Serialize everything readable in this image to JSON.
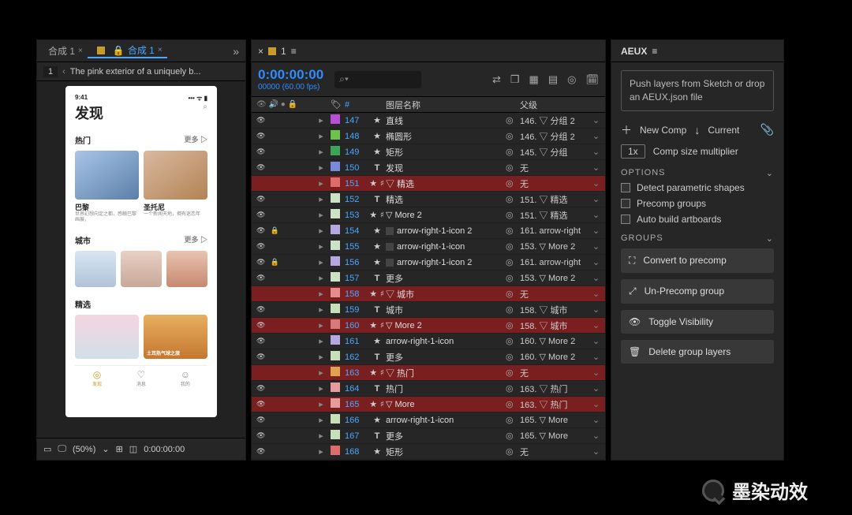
{
  "left": {
    "tab1": "合成 1",
    "tab2": "合成 1",
    "crumb_num": "1",
    "crumb_text": "The pink exterior of a uniquely b...",
    "zoom": "(50%)",
    "foot_time": "0:00:00:00",
    "phone": {
      "time": "9:41",
      "title": "发现",
      "sec_hot": "热门",
      "more": "更多 ▷",
      "card1": "巴黎",
      "card1_sub": "世界幻想向定之都，感触巴黎画展，",
      "card2": "圣托尼",
      "card2_sub": "一个新闻天地，拥有迷恋年",
      "sec_city": "城市",
      "sec_sel": "精选",
      "sel_card": "土耳热气球之旅",
      "tab_discover": "发现",
      "tab_msg": "消息",
      "tab_me": "我的"
    }
  },
  "mid": {
    "tab_num": "1",
    "timecode": "0:00:00:00",
    "fps": "00000 (60.00 fps)",
    "col_num": "#",
    "col_name": "图层名称",
    "col_parent": "父级",
    "layers": [
      {
        "n": 147,
        "c": "#b84fd8",
        "t": "★",
        "name": "直线",
        "p": "146. ▽ 分组 2",
        "eye": true
      },
      {
        "n": 148,
        "c": "#6cc24a",
        "t": "★",
        "name": "椭圆形",
        "p": "146. ▽ 分组 2",
        "eye": true
      },
      {
        "n": 149,
        "c": "#3aa655",
        "t": "★",
        "name": "矩形",
        "p": "145. ▽ 分组",
        "eye": true
      },
      {
        "n": 150,
        "c": "#7a8adb",
        "t": "T",
        "name": "发现",
        "p": "无",
        "eye": true
      },
      {
        "n": 151,
        "c": "#e06b6b",
        "t": "★ ♯",
        "name": "▽ 精选",
        "p": "无",
        "sel": true
      },
      {
        "n": 152,
        "c": "#cbe2c4",
        "t": "T",
        "name": "精选",
        "p": "151. ▽ 精选",
        "eye": true
      },
      {
        "n": 153,
        "c": "#cbe2c4",
        "t": "★ ♯",
        "name": "▽ More 2",
        "p": "151. ▽ 精选",
        "eye": true
      },
      {
        "n": 154,
        "c": "#b7a7e0",
        "t": "★",
        "pre": true,
        "name": "arrow-right-1-icon 2",
        "p": "161. arrow-right",
        "eye": true,
        "lock": true
      },
      {
        "n": 155,
        "c": "#cbe2c4",
        "t": "★",
        "pre": true,
        "name": "arrow-right-1-icon",
        "p": "153. ▽ More 2",
        "eye": true
      },
      {
        "n": 156,
        "c": "#b7a7e0",
        "t": "★",
        "pre": true,
        "name": "arrow-right-1-icon 2",
        "p": "161. arrow-right",
        "eye": true,
        "lock": true
      },
      {
        "n": 157,
        "c": "#cbe2c4",
        "t": "T",
        "name": "更多",
        "p": "153. ▽ More 2",
        "eye": true
      },
      {
        "n": 158,
        "c": "#e88b8b",
        "t": "★ ♯",
        "name": "▽ 城市",
        "p": "无",
        "sel": true
      },
      {
        "n": 159,
        "c": "#c7e0b8",
        "t": "T",
        "name": "城市",
        "p": "158. ▽ 城市",
        "eye": true
      },
      {
        "n": 160,
        "c": "#d87a7a",
        "t": "★ ♯",
        "name": "▽ More 2",
        "p": "158. ▽ 城市",
        "sel": true,
        "eye": true
      },
      {
        "n": 161,
        "c": "#b7a7e0",
        "t": "★",
        "name": "arrow-right-1-icon",
        "p": "160. ▽ More 2",
        "eye": true
      },
      {
        "n": 162,
        "c": "#c7e0b8",
        "t": "T",
        "name": "更多",
        "p": "160. ▽ More 2",
        "eye": true
      },
      {
        "n": 163,
        "c": "#e0a24f",
        "t": "★ ♯",
        "name": "▽ 热门",
        "p": "无",
        "sel": true
      },
      {
        "n": 164,
        "c": "#e89b9b",
        "t": "T",
        "name": "热门",
        "p": "163. ▽ 热门",
        "eye": true
      },
      {
        "n": 165,
        "c": "#e89b9b",
        "t": "★ ♯",
        "name": "▽ More",
        "p": "163. ▽ 热门",
        "sel": true,
        "eye": true
      },
      {
        "n": 166,
        "c": "#c7e0b8",
        "t": "★",
        "name": "arrow-right-1-icon",
        "p": "165. ▽ More",
        "eye": true
      },
      {
        "n": 167,
        "c": "#c7e0b8",
        "t": "T",
        "name": "更多",
        "p": "165. ▽ More",
        "eye": true
      },
      {
        "n": 168,
        "c": "#e06b6b",
        "t": "★",
        "name": "矩形",
        "p": "无",
        "eye": true
      }
    ]
  },
  "right": {
    "title": "AEUX",
    "drop": "Push layers from Sketch or drop an AEUX.json file",
    "newcomp": "New Comp",
    "current": "Current",
    "mult": "1x",
    "mult_label": "Comp size multiplier",
    "options_h": "OPTIONS",
    "opt1": "Detect parametric shapes",
    "opt2": "Precomp groups",
    "opt3": "Auto build artboards",
    "groups_h": "GROUPS",
    "g1": "Convert to precomp",
    "g2": "Un-Precomp group",
    "g3": "Toggle Visibility",
    "g4": "Delete group layers"
  },
  "brand": "墨染动效"
}
